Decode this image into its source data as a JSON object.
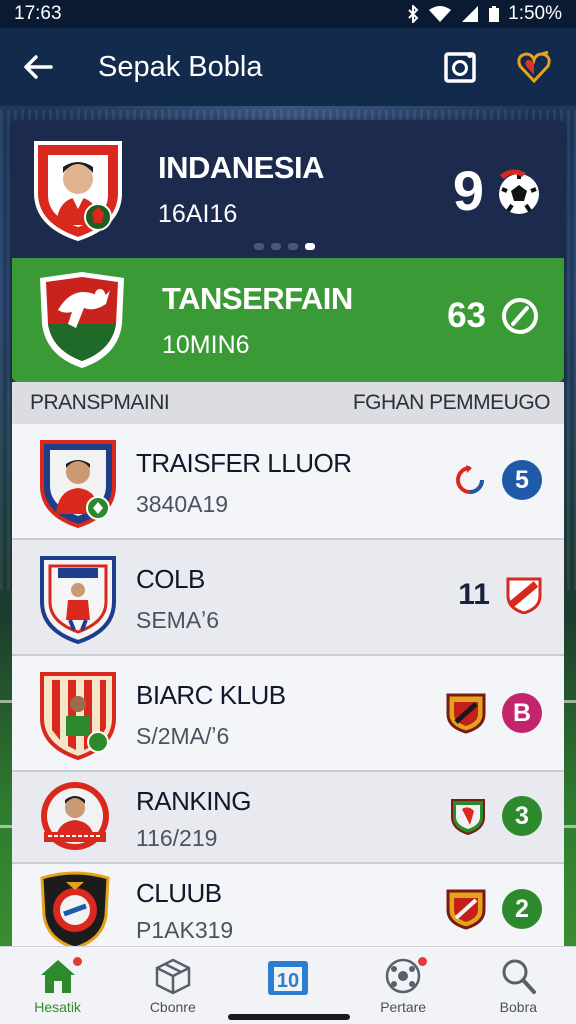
{
  "status_bar": {
    "time": "17:63",
    "battery": "1:50%"
  },
  "app_bar": {
    "title": "Sepak Bobla"
  },
  "hero": {
    "top": {
      "name": "INDANESIA",
      "subtitle": "16AI16",
      "score": "9"
    },
    "bottom": {
      "name": "TANSERFAIN",
      "subtitle": "10MIN6",
      "score": "63"
    },
    "pager_dots": 4,
    "active_dot": 3
  },
  "list_header": {
    "left": "PRANSPMAINI",
    "right": "FGHAN PEMMEUGO"
  },
  "rows": [
    {
      "name": "TRAISFER LLUOR",
      "subtitle": "3840A19",
      "count": "",
      "badge": "5",
      "badge_color": "#1f5aa8"
    },
    {
      "name": "COLB",
      "subtitle": "SEMAʼ6",
      "count": "11",
      "badge": "",
      "badge_color": ""
    },
    {
      "name": "BIARC KLUB",
      "subtitle": "S/2MA/ʼ6",
      "count": "",
      "badge": "B",
      "badge_color": "#c2256b"
    },
    {
      "name": "RANKING",
      "subtitle": "116/219",
      "count": "",
      "badge": "3",
      "badge_color": "#2c8a2c"
    },
    {
      "name": "CLUUB",
      "subtitle": "P1AK319",
      "count": "",
      "badge": "2",
      "badge_color": "#2c8a2c"
    }
  ],
  "bottom_nav": [
    {
      "label": "Hesatik",
      "icon": "home-icon",
      "active": true
    },
    {
      "label": "Cbonre",
      "icon": "box-icon",
      "active": false
    },
    {
      "label": "",
      "icon": "calendar-icon",
      "active": false
    },
    {
      "label": "Pertare",
      "icon": "ball-icon",
      "active": false
    },
    {
      "label": "Bobra",
      "icon": "search-icon",
      "active": false
    }
  ]
}
